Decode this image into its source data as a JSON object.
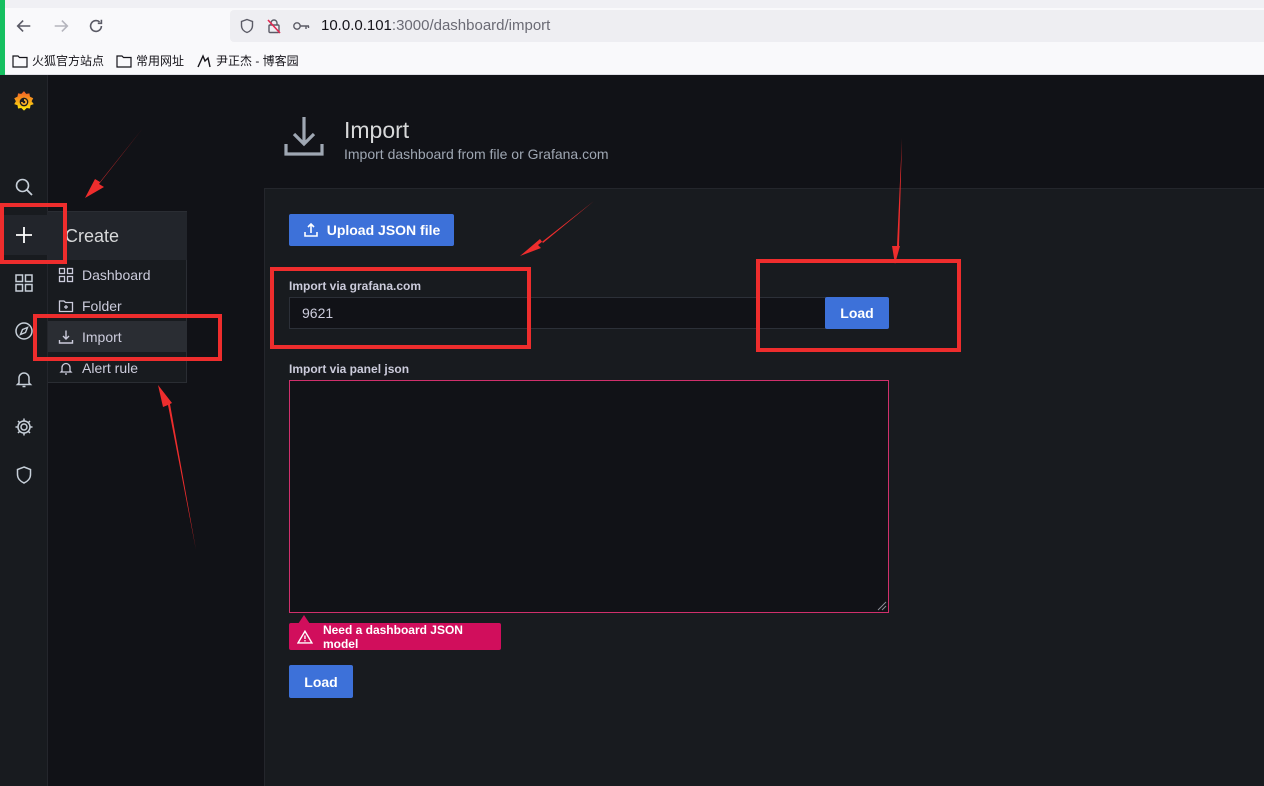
{
  "browser": {
    "url_host": "10.0.0.101",
    "url_path": ":3000/dashboard/import",
    "bookmarks": [
      {
        "label": "火狐官方站点"
      },
      {
        "label": "常用网址"
      },
      {
        "label": "尹正杰 - 博客园"
      }
    ]
  },
  "create_menu": {
    "header": "Create",
    "items": [
      {
        "label": "Dashboard"
      },
      {
        "label": "Folder"
      },
      {
        "label": "Import"
      },
      {
        "label": "Alert rule"
      }
    ]
  },
  "page": {
    "title": "Import",
    "subtitle": "Import dashboard from file or Grafana.com"
  },
  "import_form": {
    "upload_label": "Upload JSON file",
    "grafana_label": "Import via grafana.com",
    "grafana_value": "9621",
    "grafana_load": "Load",
    "panel_json_label": "Import via panel json",
    "panel_json_value": "",
    "error_text": "Need a dashboard JSON model",
    "load_label": "Load"
  },
  "colors": {
    "accent": "#3d71d9",
    "error": "#d10e5c",
    "annotation": "#ee2d2d"
  }
}
